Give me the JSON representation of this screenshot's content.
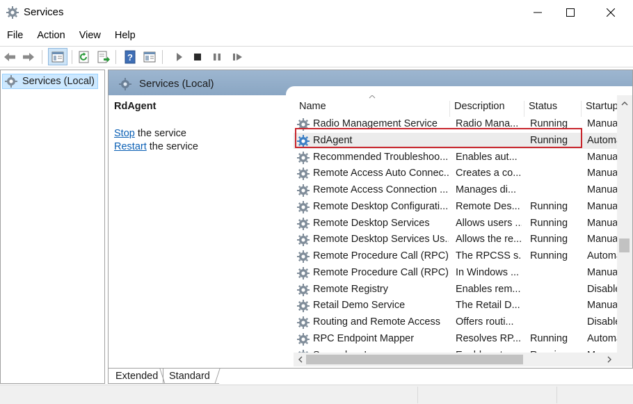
{
  "window": {
    "title": "Services"
  },
  "menu": [
    "File",
    "Action",
    "View",
    "Help"
  ],
  "tree": {
    "root_label": "Services (Local)"
  },
  "right_header": {
    "title": "Services (Local)"
  },
  "detail": {
    "service_name": "RdAgent",
    "stop_link": "Stop",
    "stop_suffix": " the service",
    "restart_link": "Restart",
    "restart_suffix": " the service"
  },
  "columns": [
    "Name",
    "Description",
    "Status",
    "Startup"
  ],
  "rows": [
    {
      "name": "Radio Management Service",
      "description": "Radio Mana...",
      "status": "Running",
      "startup": "Manual"
    },
    {
      "name": "RdAgent",
      "description": "",
      "status": "Running",
      "startup": "Automatic"
    },
    {
      "name": "Recommended Troubleshoo...",
      "description": "Enables aut...",
      "status": "",
      "startup": "Manual"
    },
    {
      "name": "Remote Access Auto Connec...",
      "description": "Creates a co...",
      "status": "",
      "startup": "Manual"
    },
    {
      "name": "Remote Access Connection ...",
      "description": "Manages di...",
      "status": "",
      "startup": "Manual"
    },
    {
      "name": "Remote Desktop Configurati...",
      "description": "Remote Des...",
      "status": "Running",
      "startup": "Manual"
    },
    {
      "name": "Remote Desktop Services",
      "description": "Allows users ...",
      "status": "Running",
      "startup": "Manual"
    },
    {
      "name": "Remote Desktop Services Us...",
      "description": "Allows the re...",
      "status": "Running",
      "startup": "Manual"
    },
    {
      "name": "Remote Procedure Call (RPC)",
      "description": "The RPCSS s...",
      "status": "Running",
      "startup": "Automatic"
    },
    {
      "name": "Remote Procedure Call (RPC)...",
      "description": "In Windows ...",
      "status": "",
      "startup": "Manual"
    },
    {
      "name": "Remote Registry",
      "description": "Enables rem...",
      "status": "",
      "startup": "Disabled"
    },
    {
      "name": "Retail Demo Service",
      "description": "The Retail D...",
      "status": "",
      "startup": "Manual"
    },
    {
      "name": "Routing and Remote Access",
      "description": "Offers routi...",
      "status": "",
      "startup": "Disabled"
    },
    {
      "name": "RPC Endpoint Mapper",
      "description": "Resolves RP...",
      "status": "Running",
      "startup": "Automatic"
    },
    {
      "name": "Secondary Logon",
      "description": "Enables star...",
      "status": "Running",
      "startup": "Manual"
    }
  ],
  "tabs": {
    "extended": "Extended",
    "standard": "Standard"
  },
  "colors": {
    "header_blue": "#9db6d0",
    "highlight_red": "#c8252c",
    "link_blue": "#0a5fb4",
    "tree_selected": "#cce8ff"
  }
}
